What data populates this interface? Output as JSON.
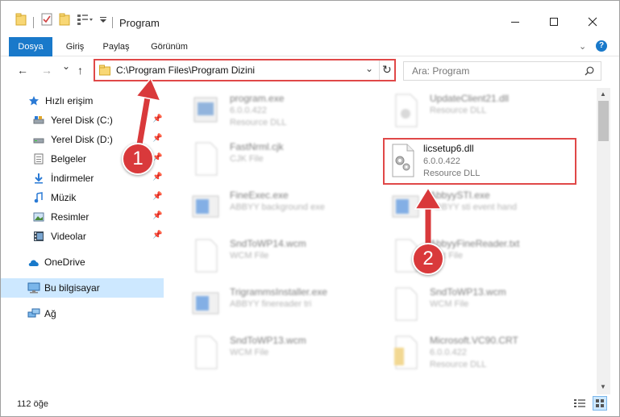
{
  "window": {
    "title": "Program",
    "controls": {
      "minimize": "—",
      "maximize": "☐",
      "close": "✕"
    }
  },
  "ribbon": {
    "tabs": [
      {
        "label": "Dosya",
        "active": true
      },
      {
        "label": "Giriş",
        "active": false
      },
      {
        "label": "Paylaş",
        "active": false
      },
      {
        "label": "Görünüm",
        "active": false
      }
    ],
    "help": "?"
  },
  "navigation": {
    "back": "←",
    "forward": "→",
    "recent": "⌄",
    "up": "↑",
    "address": "C:\\Program Files\\Program Dizini",
    "address_dropdown": "⌄",
    "refresh": "↻",
    "search_placeholder": "Ara: Program",
    "search_icon": "⌕"
  },
  "sidebar": {
    "quick_access": "Hızlı erişim",
    "pinned": [
      {
        "label": "Yerel Disk (C:)",
        "icon": "drive-icon"
      },
      {
        "label": "Yerel Disk (D:)",
        "icon": "drive-icon"
      },
      {
        "label": "Belgeler",
        "icon": "documents-icon"
      },
      {
        "label": "İndirmeler",
        "icon": "download-icon"
      },
      {
        "label": "Müzik",
        "icon": "music-icon"
      },
      {
        "label": "Resimler",
        "icon": "pictures-icon"
      },
      {
        "label": "Videolar",
        "icon": "video-icon"
      }
    ],
    "onedrive": "OneDrive",
    "this_pc": "Bu bilgisayar",
    "network": "Ağ"
  },
  "files": [
    {
      "name": "program.exe",
      "line2": "6.0.0.422",
      "line3": "Resource DLL",
      "icon": "exe-icon",
      "blurred": true
    },
    {
      "name": "UpdateClient21.dll",
      "line2": "Resource DLL",
      "line3": "",
      "icon": "dll-icon",
      "blurred": true
    },
    {
      "name": "FastNrml.cjk",
      "line2": "CJK File",
      "line3": "",
      "icon": "file-icon",
      "blurred": true
    },
    {
      "name": "licsetup6.dll",
      "line2": "6.0.0.422",
      "line3": "Resource DLL",
      "icon": "dll-gear-icon",
      "blurred": false
    },
    {
      "name": "FineExec.exe",
      "line2": "ABBYY background exe",
      "line3": "",
      "icon": "exe-icon",
      "blurred": true
    },
    {
      "name": "AbbyySTI.exe",
      "line2": "ABBYY sti event hand",
      "line3": "",
      "icon": "exe-icon",
      "blurred": true
    },
    {
      "name": "SndToWP14.wcm",
      "line2": "WCM File",
      "line3": "",
      "icon": "file-icon",
      "blurred": true
    },
    {
      "name": "AbbyyFineReader.txt",
      "line2": "Text File",
      "line3": "",
      "icon": "file-icon",
      "blurred": true
    },
    {
      "name": "TrigrammsInstaller.exe",
      "line2": "ABBYY finereader tri",
      "line3": "",
      "icon": "exe-icon",
      "blurred": true
    },
    {
      "name": "SndToWP13.wcm",
      "line2": "WCM File",
      "line3": "",
      "icon": "file-icon",
      "blurred": true
    },
    {
      "name": "SndToWP13.wcm",
      "line2": "WCM File",
      "line3": "",
      "icon": "file-icon",
      "blurred": true
    },
    {
      "name": "Microsoft.VC90.CRT",
      "line2": "6.0.0.422",
      "line3": "Resource DLL",
      "icon": "folder-icon",
      "blurred": true
    }
  ],
  "status": {
    "item_count": "112 öğe"
  },
  "annotations": {
    "step1": "1",
    "step2": "2"
  },
  "colors": {
    "accent": "#1979ca",
    "highlight": "#e04848",
    "badge": "#d9393b"
  }
}
